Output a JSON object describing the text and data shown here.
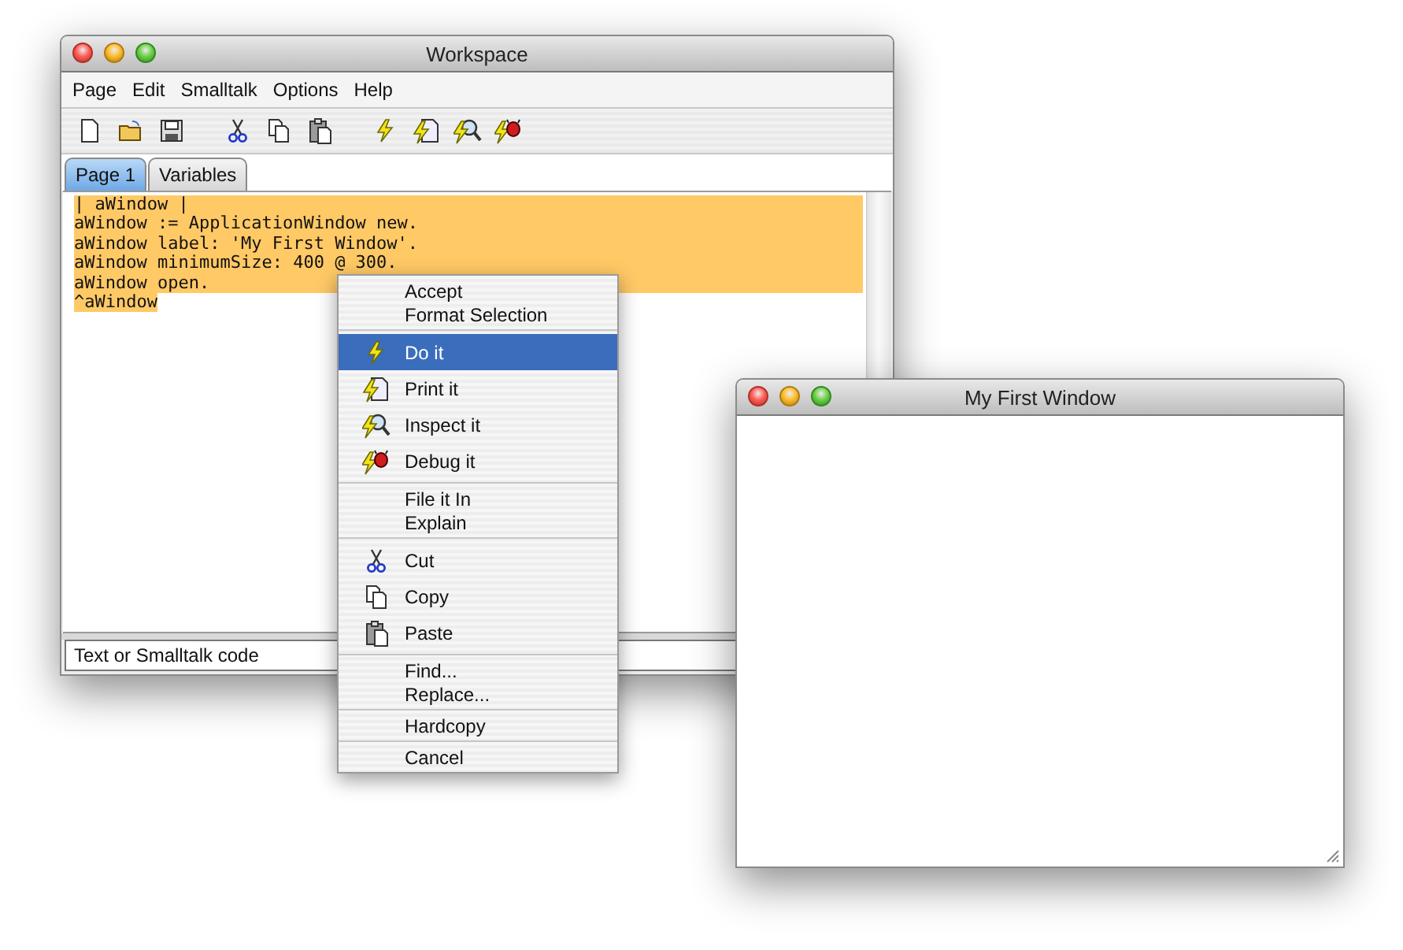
{
  "workspace": {
    "title": "Workspace",
    "menu_bar": [
      "Page",
      "Edit",
      "Smalltalk",
      "Options",
      "Help"
    ],
    "tabs": [
      {
        "label": "Page 1",
        "selected": true
      },
      {
        "label": "Variables",
        "selected": false
      }
    ],
    "code_lines": [
      {
        "text": "| aWindow |",
        "selected": true
      },
      {
        "text": "aWindow := ApplicationWindow new.",
        "selected": true
      },
      {
        "text": "aWindow label: 'My First Window'.",
        "selected": true
      },
      {
        "text": "aWindow minimumSize: 400 @ 300.",
        "selected": true
      },
      {
        "text": "aWindow open.",
        "selected": true
      },
      {
        "text": "^aWindow",
        "selected": true
      }
    ],
    "status_field": {
      "value": "Text or Smalltalk code"
    }
  },
  "context_menu": [
    {
      "kind": "plain",
      "items": [
        {
          "label": "Accept",
          "selected": false
        },
        {
          "label": "Format Selection",
          "selected": false
        }
      ]
    },
    {
      "kind": "icons",
      "items": [
        {
          "label": "Do it",
          "selected": true
        },
        {
          "label": "Print it",
          "selected": false
        },
        {
          "label": "Inspect it",
          "selected": false
        },
        {
          "label": "Debug it",
          "selected": false
        }
      ]
    },
    {
      "kind": "plain",
      "items": [
        {
          "label": "File it In",
          "selected": false
        },
        {
          "label": "Explain",
          "selected": false
        }
      ]
    },
    {
      "kind": "icons",
      "items": [
        {
          "label": "Cut",
          "selected": false
        },
        {
          "label": "Copy",
          "selected": false
        },
        {
          "label": "Paste",
          "selected": false
        }
      ]
    },
    {
      "kind": "plain",
      "items": [
        {
          "label": "Find...",
          "selected": false
        },
        {
          "label": "Replace...",
          "selected": false
        }
      ]
    },
    {
      "kind": "plain",
      "items": [
        {
          "label": "Hardcopy",
          "selected": false
        }
      ]
    },
    {
      "kind": "plain",
      "items": [
        {
          "label": "Cancel",
          "selected": false
        }
      ]
    }
  ],
  "new_window": {
    "title": "My First Window"
  }
}
